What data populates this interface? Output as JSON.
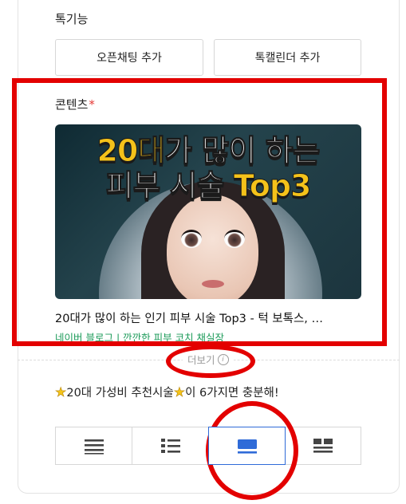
{
  "features": {
    "label": "톡기능",
    "buttons": [
      "오픈채팅 추가",
      "톡캘린더 추가"
    ]
  },
  "content": {
    "label": "콘텐츠",
    "required_mark": "*",
    "thumbnail": {
      "line1_highlight": "20대",
      "line1_rest": "가 많이 하는",
      "line2_rest": "피부 시술 ",
      "line2_highlight": "Top3"
    },
    "post_title": "20대가 많이 하는 인기 피부 시술 Top3 - 턱 보톡스, …",
    "post_source": "네이버 블로그 | 깐깐한 피부 코치 채실장"
  },
  "more": {
    "label": "더보기",
    "info_glyph": "i"
  },
  "promo": {
    "text_a": "20대 가성비 추천시술",
    "text_b": " 이 6가지면 충분해!"
  },
  "layout_options": {
    "icons": [
      "list-icon",
      "bullet-list-icon",
      "card-icon",
      "grid-icon"
    ],
    "selected_index": 2,
    "active_color": "#2f6bd8"
  },
  "colors": {
    "required": "#e53935",
    "source": "#1d9b5a",
    "annotation": "#e30000",
    "thumb_highlight": "#f4c21a"
  }
}
